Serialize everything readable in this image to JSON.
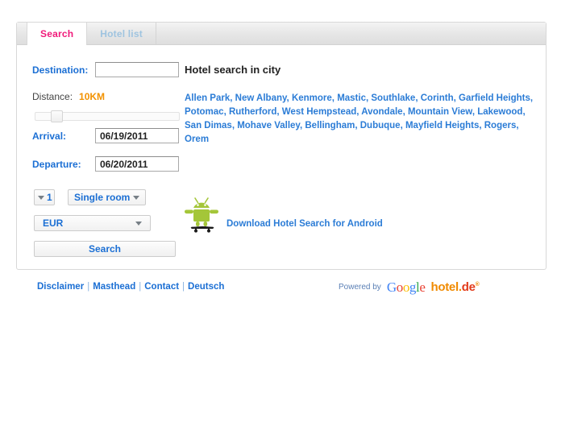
{
  "tabs": [
    {
      "label": "Search",
      "active": true
    },
    {
      "label": "Hotel list",
      "active": false
    }
  ],
  "form": {
    "destination_label": "Destination:",
    "destination_value": "",
    "destination_placeholder": "",
    "distance_label": "Distance:",
    "distance_value": "10KM",
    "slider_position_percent": 12,
    "arrival_label": "Arrival:",
    "arrival_value": "06/19/2011",
    "departure_label": "Departure:",
    "departure_value": "06/20/2011",
    "room_count_value": "1",
    "room_type_value": "Single room",
    "currency_value": "EUR",
    "search_label": "Search"
  },
  "city_panel": {
    "title": "Hotel search in city",
    "cities": [
      "Allen Park",
      "New Albany",
      "Kenmore",
      "Mastic",
      "Southlake",
      "Corinth",
      "Garfield Heights",
      "Potomac",
      "Rutherford",
      "West Hempstead",
      "Avondale",
      "Mountain View",
      "Lakewood",
      "San Dimas",
      "Mohave Valley",
      "Bellingham",
      "Dubuque",
      "Mayfield Heights",
      "Rogers",
      "Orem"
    ],
    "separator": ","
  },
  "android": {
    "link_label": "Download Hotel Search for Android",
    "icon": "android-robot-skateboard-icon",
    "body_color": "#a4c639",
    "board_color": "#1a1a1a"
  },
  "footer": {
    "links": [
      "Disclaimer",
      "Masthead",
      "Contact",
      "Deutsch"
    ],
    "separator": "|",
    "powered_by_label": "Powered by",
    "google_logo_letters": [
      "G",
      "o",
      "o",
      "g",
      "l",
      "e"
    ],
    "hotelde_main": "hotel.",
    "hotelde_tld": "de",
    "hotelde_tm": "®"
  },
  "colors": {
    "tab_active_text": "#f01a7a",
    "tab_inactive_text": "#9fc4e0",
    "label_blue": "#1b6fd4",
    "link_blue": "#2b7cd6",
    "distance_orange": "#f39200",
    "android_green": "#a4c639"
  }
}
